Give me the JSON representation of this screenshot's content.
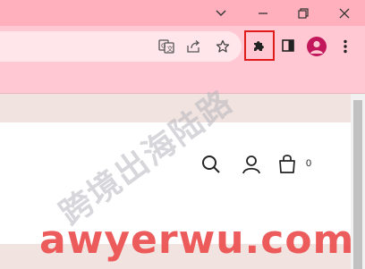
{
  "browser": {
    "window_controls": {
      "tab_search": "chevron-down-icon",
      "minimize": "minimize-icon",
      "restore": "restore-icon",
      "close": "close-icon"
    },
    "toolbar": {
      "omnibox_icons": [
        "translate-icon",
        "share-icon",
        "bookmark-star-icon"
      ],
      "extensions_icon": "puzzle-icon",
      "side_panel_icon": "side-panel-icon",
      "profile_icon": "avatar",
      "menu_icon": "kebab-menu-icon",
      "highlight_color": "#e01b1b"
    }
  },
  "site_header": {
    "icons": [
      "search-icon",
      "account-icon",
      "cart-icon"
    ],
    "cart_count": "0"
  },
  "watermark": {
    "chinese": "跨境出海陆路",
    "english": "awyerwu.com"
  },
  "colors": {
    "titlebar": "#ffb0bc",
    "toolbar": "#ffc8d2",
    "profile": "#c2185b",
    "page_strip": "#f1e4e0"
  }
}
